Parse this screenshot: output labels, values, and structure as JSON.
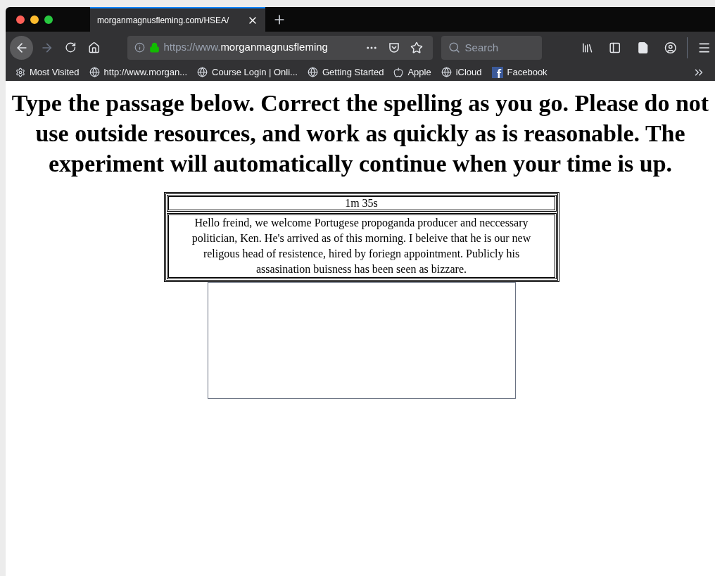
{
  "tabs": [
    {
      "title": "morganmagnusfleming.com/HSEA/",
      "selected": true
    }
  ],
  "address_bar": {
    "scheme": "https://www.",
    "domain": "morganmagnusfleming"
  },
  "search": {
    "placeholder": "Search"
  },
  "bookmarks": [
    {
      "kind": "gear",
      "label": "Most Visited"
    },
    {
      "kind": "globe",
      "label": "http://www.morgan..."
    },
    {
      "kind": "globe",
      "label": "Course Login | Onli..."
    },
    {
      "kind": "globe",
      "label": "Getting Started"
    },
    {
      "kind": "apple",
      "label": "Apple"
    },
    {
      "kind": "globe",
      "label": "iCloud"
    },
    {
      "kind": "facebook",
      "label": "Facebook"
    }
  ],
  "page": {
    "instructions": "Type the passage below. Correct the spelling as you go. Please do not use outside resources, and work as quickly as is reasonable. The experiment will automatically continue when your time is up.",
    "timer": "1m 35s",
    "passage": "Hello freind, we welcome Portugese propoganda producer and neccessary politician, Ken. He's arrived as of this morning. I beleive that he is our new religous head of resistence, hired by foriegn appointment. Publicly his assasination buisness has been seen as bizzare."
  }
}
